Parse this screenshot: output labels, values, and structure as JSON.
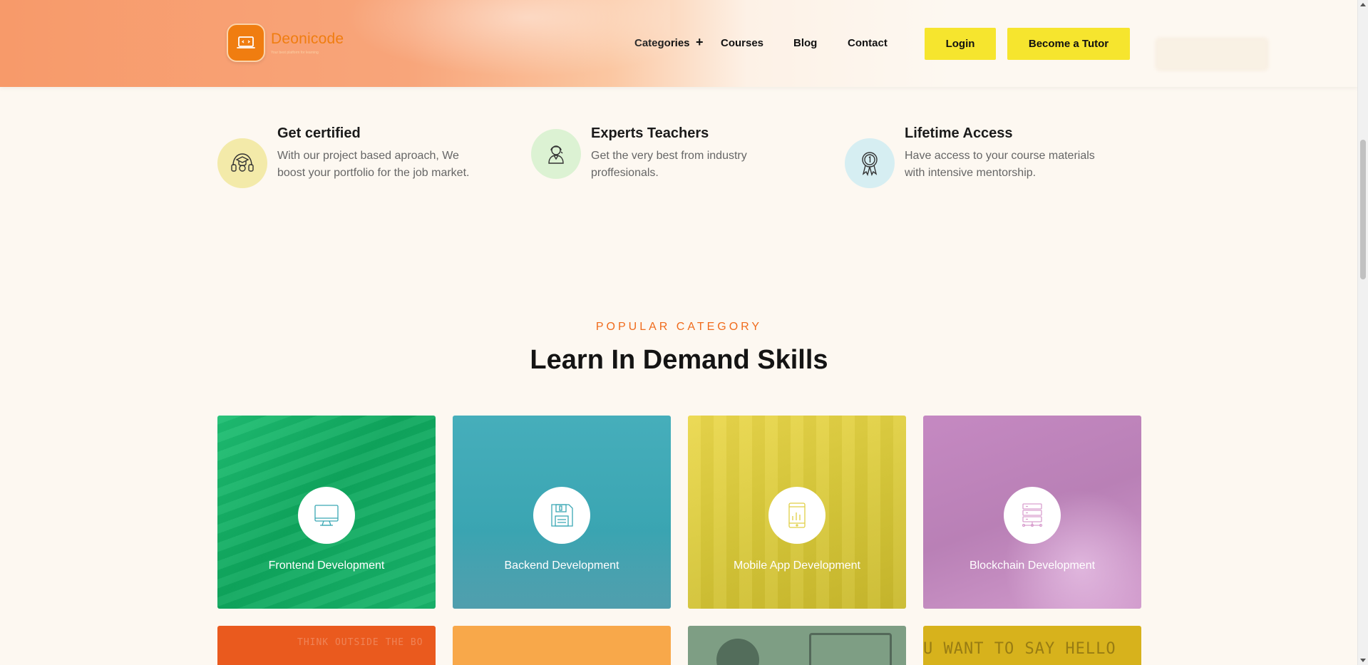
{
  "brand": {
    "name": "Deonicode",
    "tagline": "Your best platform for learning"
  },
  "nav": {
    "categories": "Categories",
    "courses": "Courses",
    "blog": "Blog",
    "contact": "Contact",
    "plus_glyph": "+"
  },
  "buttons": {
    "login": "Login",
    "become_tutor": "Become a Tutor"
  },
  "features": [
    {
      "title": "Get certified",
      "desc": "With our project based aproach, We boost your portfolio for the job market.",
      "icon": "graduate-headset-icon",
      "color": "#f3eaa9"
    },
    {
      "title": "Experts Teachers",
      "desc": "Get the very best from industry proffesionals.",
      "icon": "teacher-icon",
      "color": "#dcf2d3"
    },
    {
      "title": "Lifetime Access",
      "desc": "Have access to your course materials with intensive mentorship.",
      "icon": "award-medal-icon",
      "color": "#d6eef2"
    }
  ],
  "section": {
    "eyebrow": "POPULAR CATEGORY",
    "title": "Learn In Demand Skills"
  },
  "categories": [
    {
      "label": "Frontend Development",
      "icon": "monitor-icon",
      "color": "#14b86a"
    },
    {
      "label": "Backend Development",
      "icon": "floppy-disk-icon",
      "color": "#3aa7b4"
    },
    {
      "label": "Mobile App Development",
      "icon": "tablet-chart-icon",
      "color": "#dccb3a"
    },
    {
      "label": "Blockchain Development",
      "icon": "server-network-icon",
      "color": "#c88ac0"
    }
  ],
  "bottom_cards": [
    {
      "color": "#ea5a1e",
      "text": "THINK OUTSIDE THE BO"
    },
    {
      "color": "#f8a84a",
      "text": ""
    },
    {
      "color": "#7e9e84",
      "text": ""
    },
    {
      "color": "#d7b21c",
      "text": "U WANT TO SAY HELLO"
    }
  ]
}
